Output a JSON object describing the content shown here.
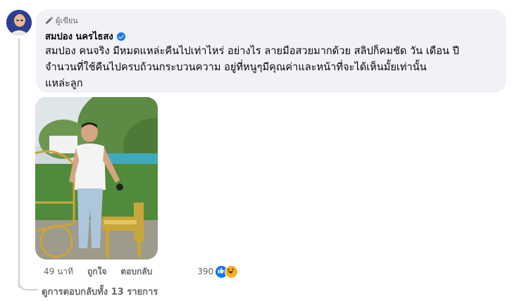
{
  "comment": {
    "author_badge": "ผู้เขียน",
    "author_name": "สมปอง นครไธสง",
    "text": "สมปอง คนจริง มีหมดแหล่ะคืนไปเท่าไหร่ อย่างไร ลายมือสวยมากด้วย สลิปก็คมชัด วัน เดือน ปี\nจำนวนที่ใช้คืนไปครบถ้วนกระบวนความ อยู่ที่หนูๆมีคุณค่าและหน้าที่จะได้เห็นมั้ยเท่านั้น\nแหล่ะลูก",
    "time": "49 นาที",
    "like_action": "ถูกใจ",
    "reply_action": "ตอบกลับ",
    "reaction_count": "390",
    "reactions": [
      "like-icon",
      "haha-icon"
    ]
  },
  "replies_link": "ดูการตอบกลับทั้ง 13 รายการ",
  "colors": {
    "bubble_bg": "#f0f2f5",
    "secondary_text": "#65676b",
    "verified_blue": "#1877f2"
  }
}
